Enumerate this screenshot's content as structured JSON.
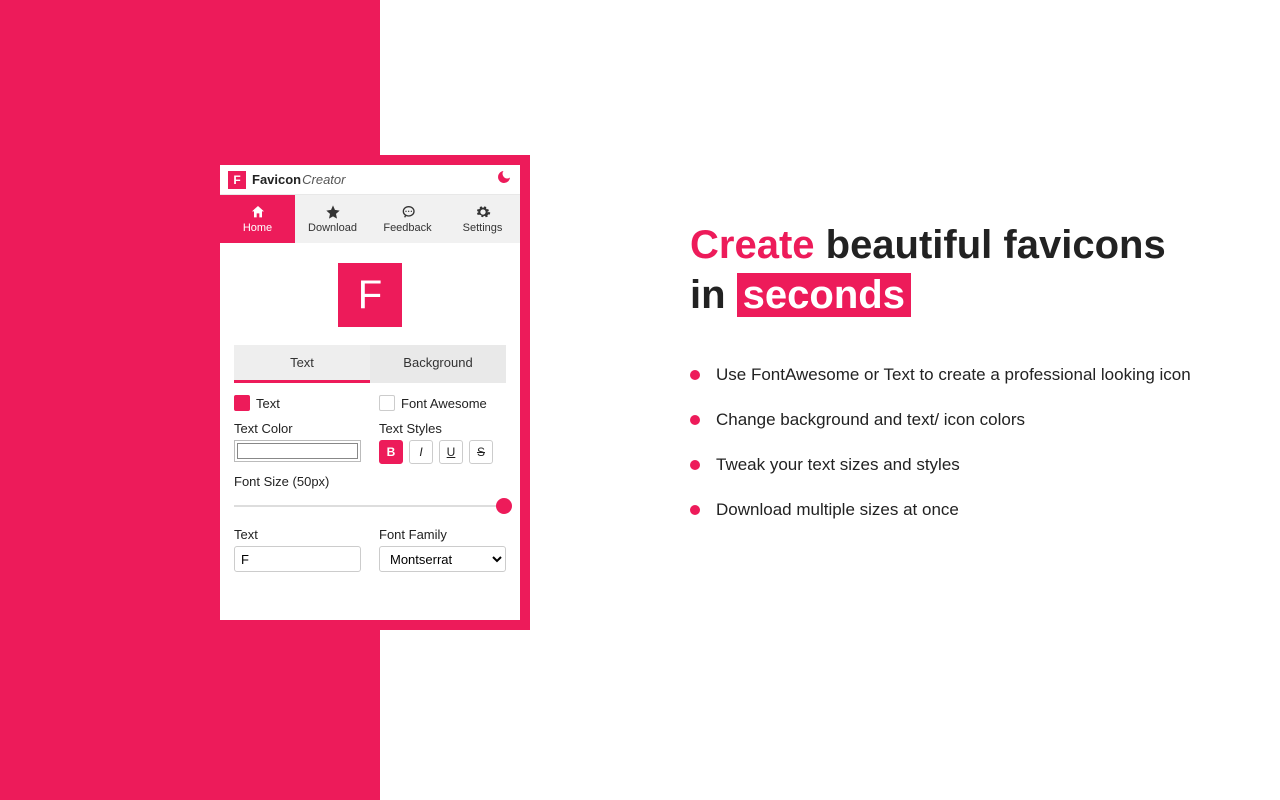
{
  "brand": {
    "logo_letter": "F",
    "name_strong": "Favicon",
    "name_italic": "Creator"
  },
  "nav": {
    "home": "Home",
    "download": "Download",
    "feedback": "Feedback",
    "settings": "Settings"
  },
  "preview": {
    "letter": "F"
  },
  "section_tabs": {
    "text": "Text",
    "background": "Background"
  },
  "form": {
    "opt_text": "Text",
    "opt_fontawesome": "Font Awesome",
    "text_color_label": "Text Color",
    "text_styles_label": "Text Styles",
    "style_b": "B",
    "style_i": "I",
    "style_u": "U",
    "style_s": "S",
    "font_size_label": "Font Size (50px)",
    "text_label": "Text",
    "text_value": "F",
    "font_family_label": "Font Family",
    "font_family_value": "Montserrat"
  },
  "marketing": {
    "h_create": "Create",
    "h_middle": " beautiful favicons in ",
    "h_seconds": "seconds",
    "bullets": [
      "Use FontAwesome or Text to create a professional looking icon",
      "Change background and text/ icon colors",
      "Tweak your text sizes and styles",
      "Download multiple sizes at once"
    ]
  }
}
